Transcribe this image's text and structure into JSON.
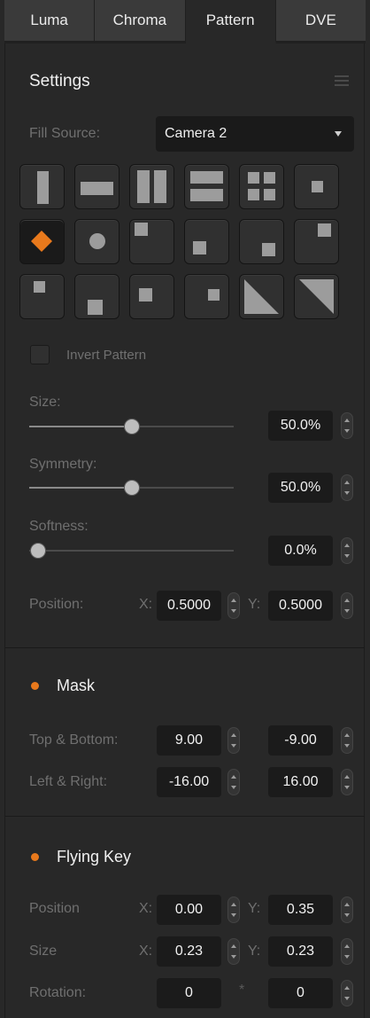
{
  "tabs": [
    "Luma",
    "Chroma",
    "Pattern",
    "DVE"
  ],
  "active_tab": "Pattern",
  "settings": {
    "title": "Settings",
    "fill_source_label": "Fill Source:",
    "fill_source_value": "Camera 2",
    "invert_pattern_label": "Invert Pattern",
    "invert_pattern_checked": false,
    "patterns": [
      "vertical-bar-wipe",
      "horizontal-bar-wipe",
      "vertical-barn-door",
      "horizontal-barn-door",
      "corner-box-4",
      "box-center",
      "diamond",
      "circle",
      "box-top-left",
      "box-top-center",
      "box-bottom-left",
      "box-top-right",
      "box-left-center",
      "box-bottom-center",
      "box-center-small",
      "box-right-center",
      "diagonal-bottom-left",
      "diagonal-bottom-right"
    ],
    "selected_pattern": "diamond",
    "accent_color": "#e8791c",
    "size": {
      "label": "Size:",
      "value": "50.0%",
      "level": 0.5
    },
    "symmetry": {
      "label": "Symmetry:",
      "value": "50.0%",
      "level": 0.5
    },
    "softness": {
      "label": "Softness:",
      "value": "0.0%",
      "level": 0.0
    },
    "position": {
      "label": "Position:",
      "x_label": "X:",
      "x": "0.5000",
      "y_label": "Y:",
      "y": "0.5000"
    }
  },
  "mask": {
    "title": "Mask",
    "enabled": true,
    "top_bottom": {
      "label": "Top & Bottom:",
      "a": "9.00",
      "b": "-9.00"
    },
    "left_right": {
      "label": "Left & Right:",
      "a": "-16.00",
      "b": "16.00"
    }
  },
  "flying_key": {
    "title": "Flying Key",
    "enabled": true,
    "position": {
      "label": "Position",
      "x_label": "X:",
      "x": "0.00",
      "y_label": "Y:",
      "y": "0.35"
    },
    "size": {
      "label": "Size",
      "x_label": "X:",
      "x": "0.23",
      "y_label": "Y:",
      "y": "0.23"
    },
    "rotation": {
      "label": "Rotation:",
      "a": "0",
      "sep": "*",
      "b": "0"
    }
  }
}
